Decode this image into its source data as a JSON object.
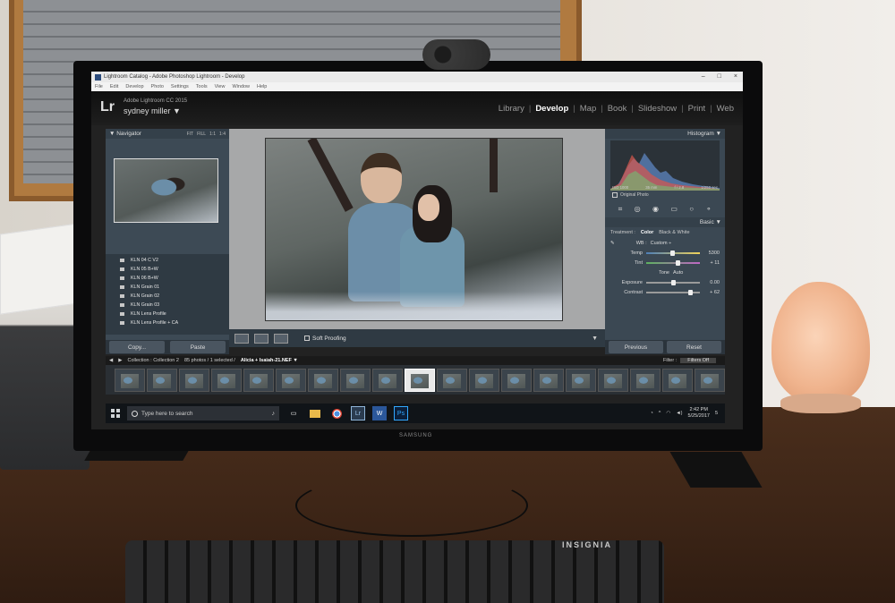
{
  "window": {
    "title": "Lightroom Catalog - Adobe Photoshop Lightroom - Develop",
    "controls": [
      "–",
      "□",
      "×"
    ]
  },
  "menu": [
    "File",
    "Edit",
    "Develop",
    "Photo",
    "Settings",
    "Tools",
    "View",
    "Window",
    "Help"
  ],
  "identity": {
    "logo": "Lr",
    "version": "Adobe Lightroom CC 2015",
    "user": "sydney miller ▼"
  },
  "modules": {
    "library": "Library",
    "develop": "Develop",
    "map": "Map",
    "book": "Book",
    "slideshow": "Slideshow",
    "print": "Print",
    "web": "Web",
    "active": "Develop"
  },
  "navigator": {
    "title": "▼ Navigator",
    "fit": "FIT",
    "fill": "FILL",
    "one_to_one": "1:1",
    "ratio": "1:4"
  },
  "presets": [
    "KLN 04 C V2",
    "KLN 05 B+W",
    "KLN 06 B+W",
    "KLN Grain 01",
    "KLN Grain 02",
    "KLN Grain 03",
    "KLN Lens Profile",
    "KLN Lens Profile + CA"
  ],
  "left_buttons": {
    "copy": "Copy...",
    "paste": "Paste"
  },
  "toolbar": {
    "soft_proofing": "Soft Proofing",
    "arrow": "▼"
  },
  "histogram": {
    "title": "Histogram ▼",
    "iso": "ISO 1000",
    "focal": "35 mm",
    "aperture": "f / 2.8",
    "shutter": "1/250 sec",
    "original_photo": "Original Photo"
  },
  "basic": {
    "title": "Basic ▼",
    "treatment_label": "Treatment :",
    "color": "Color",
    "bw": "Black & White",
    "wb_label": "WB :",
    "wb_value": "Custom ÷",
    "temp_label": "Temp",
    "temp_value": "5300",
    "tint_label": "Tint",
    "tint_value": "+ 11",
    "tone_label": "Tone",
    "auto_label": "Auto",
    "exposure_label": "Exposure",
    "exposure_value": "0.00",
    "contrast_label": "Contrast",
    "contrast_value": "+ 62"
  },
  "right_buttons": {
    "previous": "Previous",
    "reset": "Reset"
  },
  "filmstrip": {
    "collection": "Collection : Collection 2",
    "count": "85 photos / 1 selected /",
    "filename": "Alicia + Isaiah-21.NEF ▼",
    "filter_label": "Filter :",
    "filter_value": "Filters Off",
    "thumb_count": 19,
    "selected_index": 9
  },
  "taskbar": {
    "search_placeholder": "Type here to search",
    "time": "2:42 PM",
    "date": "5/25/2017",
    "notification_count": "5"
  },
  "hardware": {
    "monitor_brand": "SAMSUNG",
    "keyboard_brand": "INSIGNIA"
  }
}
